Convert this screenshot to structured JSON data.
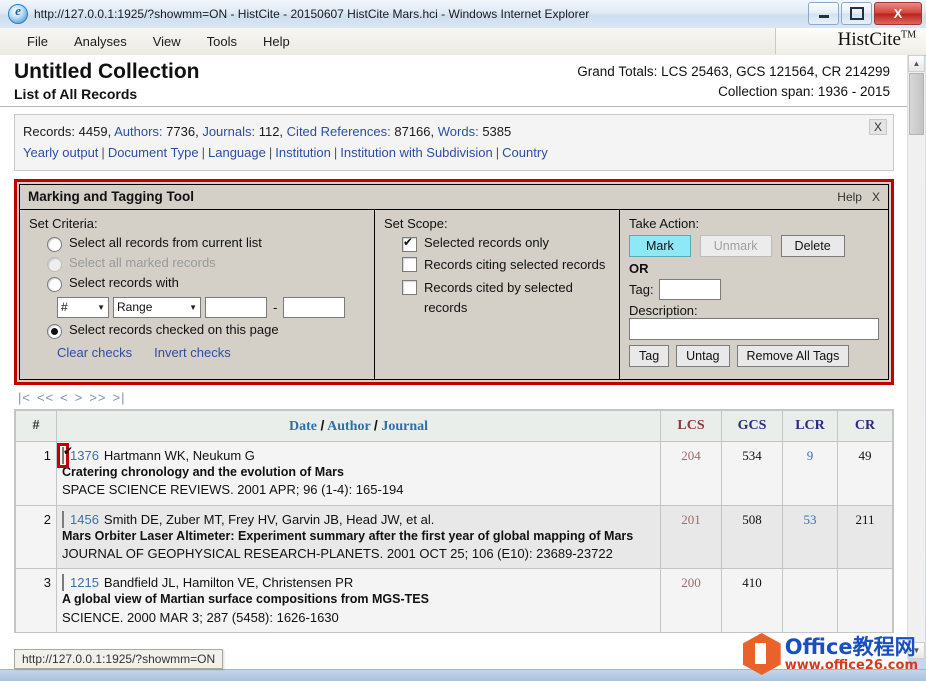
{
  "window": {
    "title": "http://127.0.0.1:1925/?showmm=ON - HistCite - 20150607 HistCite Mars.hci - Windows Internet Explorer",
    "minimize_label": "Minimize",
    "maximize_label": "Maximize",
    "close_label": "X"
  },
  "menu": {
    "items": [
      {
        "label": "File"
      },
      {
        "label": "Analyses"
      },
      {
        "label": "View"
      },
      {
        "label": "Tools"
      },
      {
        "label": "Help"
      }
    ],
    "brand": "HistCite",
    "brand_sup": "TM"
  },
  "collection": {
    "title": "Untitled Collection",
    "subtitle": "List of All Records",
    "grand_totals": "Grand Totals: LCS 25463, GCS 121564, CR 214299",
    "span": "Collection span: 1936 - 2015"
  },
  "stats": {
    "records_label": "Records:",
    "records_value": "4459,",
    "authors_label": "Authors:",
    "authors_value": "7736,",
    "journals_label": "Journals:",
    "journals_value": "112,",
    "cited_refs_label": "Cited References:",
    "cited_refs_value": "87166,",
    "words_label": "Words:",
    "words_value": "5385",
    "close_label": "X",
    "links": [
      "Yearly output",
      "Document Type",
      "Language",
      "Institution",
      "Institution with Subdivision",
      "Country"
    ]
  },
  "marking_tool": {
    "title": "Marking and Tagging Tool",
    "help_label": "Help",
    "close_label": "X",
    "criteria": {
      "legend": "Set Criteria:",
      "option_all_current": "Select all records from current list",
      "option_all_marked": "Select all marked records",
      "option_records_with": "Select records with",
      "field_select_value": "#",
      "mode_select_value": "Range",
      "range_from": "",
      "range_to": "",
      "range_dash": "-",
      "option_checked_page": "Select records checked on this page",
      "clear_checks": "Clear checks",
      "invert_checks": "Invert checks"
    },
    "scope": {
      "legend": "Set Scope:",
      "selected_only": "Selected records only",
      "citing_selected": "Records citing selected records",
      "cited_by_selected": "Records cited by selected records"
    },
    "action": {
      "legend": "Take Action:",
      "mark": "Mark",
      "unmark": "Unmark",
      "delete": "Delete",
      "or": "OR",
      "tag_label": "Tag:",
      "tag_value": "",
      "description_label": "Description:",
      "description_value": "",
      "tag_button": "Tag",
      "untag_button": "Untag",
      "remove_all_tags": "Remove All Tags"
    }
  },
  "pager": {
    "first": "|<",
    "prev_block": "<<",
    "prev": "<",
    "next": ">",
    "next_block": ">>",
    "last": ">|"
  },
  "table": {
    "headers": {
      "num": "#",
      "main_date": "Date",
      "main_author": "Author",
      "main_journal": "Journal",
      "slash": "/",
      "lcs": "LCS",
      "gcs": "GCS",
      "lcr": "LCR",
      "cr": "CR"
    },
    "rows": [
      {
        "index": "1",
        "checked": true,
        "highlight": true,
        "record_id": "1376",
        "authors": "Hartmann WK, Neukum G",
        "title": "Cratering chronology and the evolution of Mars",
        "source": "SPACE SCIENCE REVIEWS. 2001 APR; 96 (1-4): 165-194",
        "lcs": "204",
        "gcs": "534",
        "lcr": "9",
        "cr": "49"
      },
      {
        "index": "2",
        "checked": false,
        "highlight": false,
        "record_id": "1456",
        "authors": "Smith DE, Zuber MT, Frey HV, Garvin JB, Head JW, et al.",
        "title": "Mars Orbiter Laser Altimeter: Experiment summary after the first year of global mapping of Mars",
        "source": "JOURNAL OF GEOPHYSICAL RESEARCH-PLANETS. 2001 OCT 25; 106 (E10): 23689-23722",
        "lcs": "201",
        "gcs": "508",
        "lcr": "53",
        "cr": "211"
      },
      {
        "index": "3",
        "checked": false,
        "highlight": false,
        "record_id": "1215",
        "authors": "Bandfield JL, Hamilton VE, Christensen PR",
        "title": "A global view of Martian surface compositions from MGS-TES",
        "source": "SCIENCE. 2000 MAR 3; 287 (5458): 1626-1630",
        "lcs": "200",
        "gcs": "410",
        "lcr": "",
        "cr": ""
      }
    ]
  },
  "status_tip": {
    "text": "http://127.0.0.1:1925/?showmm=ON"
  },
  "watermark": {
    "top": "Office教程网",
    "bottom": "www.office26.com"
  },
  "colors": {
    "accent_red": "#c00000",
    "link_blue": "#2a4fa2",
    "mark_cyan": "#8ce9f5",
    "lcs_red": "#8b3a3a",
    "gcs_navy": "#2b2b7a"
  }
}
